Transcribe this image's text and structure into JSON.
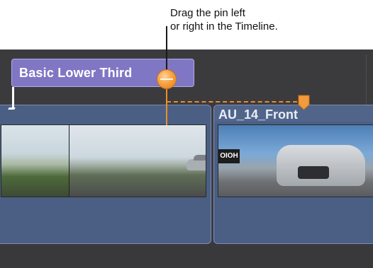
{
  "callout": {
    "line1": "Drag the pin left",
    "line2": "or right in the Timeline."
  },
  "timeline": {
    "title_clip": {
      "label": "Basic Lower Third",
      "color": "#7f77c4"
    },
    "clips": [
      {
        "name": ""
      },
      {
        "name": "AU_14_Front",
        "filmstrip_text": "OIOH"
      }
    ],
    "pin_color": "#ee8d2b",
    "clip_color": "#4b5f85"
  },
  "icons": {
    "pin": "orange-pin-handle",
    "flag": "orange-position-flag"
  }
}
